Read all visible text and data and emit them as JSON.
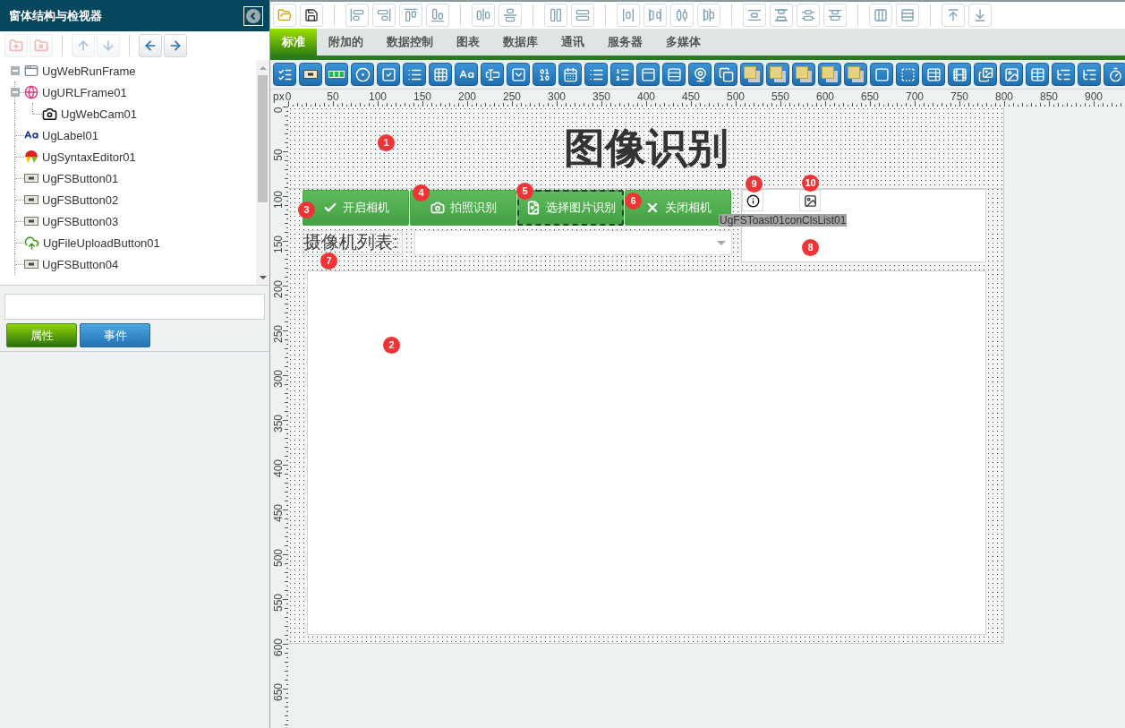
{
  "inspector": {
    "title": "窗体结构与检视器",
    "toolbar": [
      {
        "kind": "add",
        "disabled": true
      },
      {
        "kind": "delete",
        "disabled": true
      },
      {
        "kind": "move_up",
        "disabled": true
      },
      {
        "kind": "move_down",
        "disabled": true
      },
      {
        "kind": "move_left",
        "disabled": false
      },
      {
        "kind": "move_right",
        "disabled": false
      }
    ],
    "tree": [
      {
        "label": "UgWebRunFrame",
        "kind": "frame",
        "expanded": true,
        "children": [
          {
            "label": "UgURLFrame01",
            "kind": "url_frame",
            "expanded": true,
            "children": [
              {
                "label": "UgWebCam01",
                "kind": "webcam"
              }
            ]
          },
          {
            "label": "UgLabel01",
            "kind": "label"
          },
          {
            "label": "UgSyntaxEditor01",
            "kind": "syntax_editor"
          },
          {
            "label": "UgFSButton01",
            "kind": "button"
          },
          {
            "label": "UgFSButton02",
            "kind": "button"
          },
          {
            "label": "UgFSButton03",
            "kind": "button"
          },
          {
            "label": "UgFileUploadButton01",
            "kind": "upload"
          },
          {
            "label": "UgFSButton04",
            "kind": "button"
          }
        ]
      }
    ],
    "tabs": [
      {
        "label": "属性",
        "selected": true
      },
      {
        "label": "事件",
        "selected": false
      }
    ]
  },
  "component_tabs": [
    {
      "label": "标准",
      "selected": true
    },
    {
      "label": "附加的",
      "selected": false
    },
    {
      "label": "数据控制",
      "selected": false
    },
    {
      "label": "图表",
      "selected": false
    },
    {
      "label": "数据库",
      "selected": false
    },
    {
      "label": "通讯",
      "selected": false
    },
    {
      "label": "服务器",
      "selected": false
    },
    {
      "label": "多媒体",
      "selected": false
    }
  ],
  "ruler": {
    "unit": "px",
    "x_labels": [
      "0",
      "50",
      "100",
      "150",
      "200",
      "250",
      "300",
      "350",
      "400",
      "450",
      "500",
      "550",
      "600",
      "650",
      "700",
      "750",
      "800",
      "850",
      "900"
    ],
    "y_labels": [
      "0",
      "50",
      "100",
      "150",
      "200",
      "250",
      "300",
      "350",
      "400",
      "450",
      "500",
      "550",
      "600",
      "650"
    ]
  },
  "form": {
    "title": {
      "text": "图像识别",
      "marker": "1"
    },
    "buttons": [
      {
        "label": "开启相机",
        "kind": "check",
        "focused": false,
        "marker": "3"
      },
      {
        "label": "拍照识别",
        "kind": "camera",
        "focused": false,
        "marker": "4"
      },
      {
        "label": "选择图片识别",
        "kind": "file_image",
        "focused": true,
        "marker": "5"
      },
      {
        "label": "关闭相机",
        "kind": "close",
        "focused": false,
        "marker": "6"
      }
    ],
    "camera_list": {
      "label": "摄像机列表:",
      "marker": "7"
    },
    "list_panel": {
      "marker": "8",
      "name_tag": "UgFSToast01conClsList01",
      "tools": [
        {
          "kind": "info",
          "marker": "9"
        },
        {
          "kind": "image",
          "marker": "10"
        }
      ]
    },
    "editor": {
      "marker": "2"
    }
  }
}
